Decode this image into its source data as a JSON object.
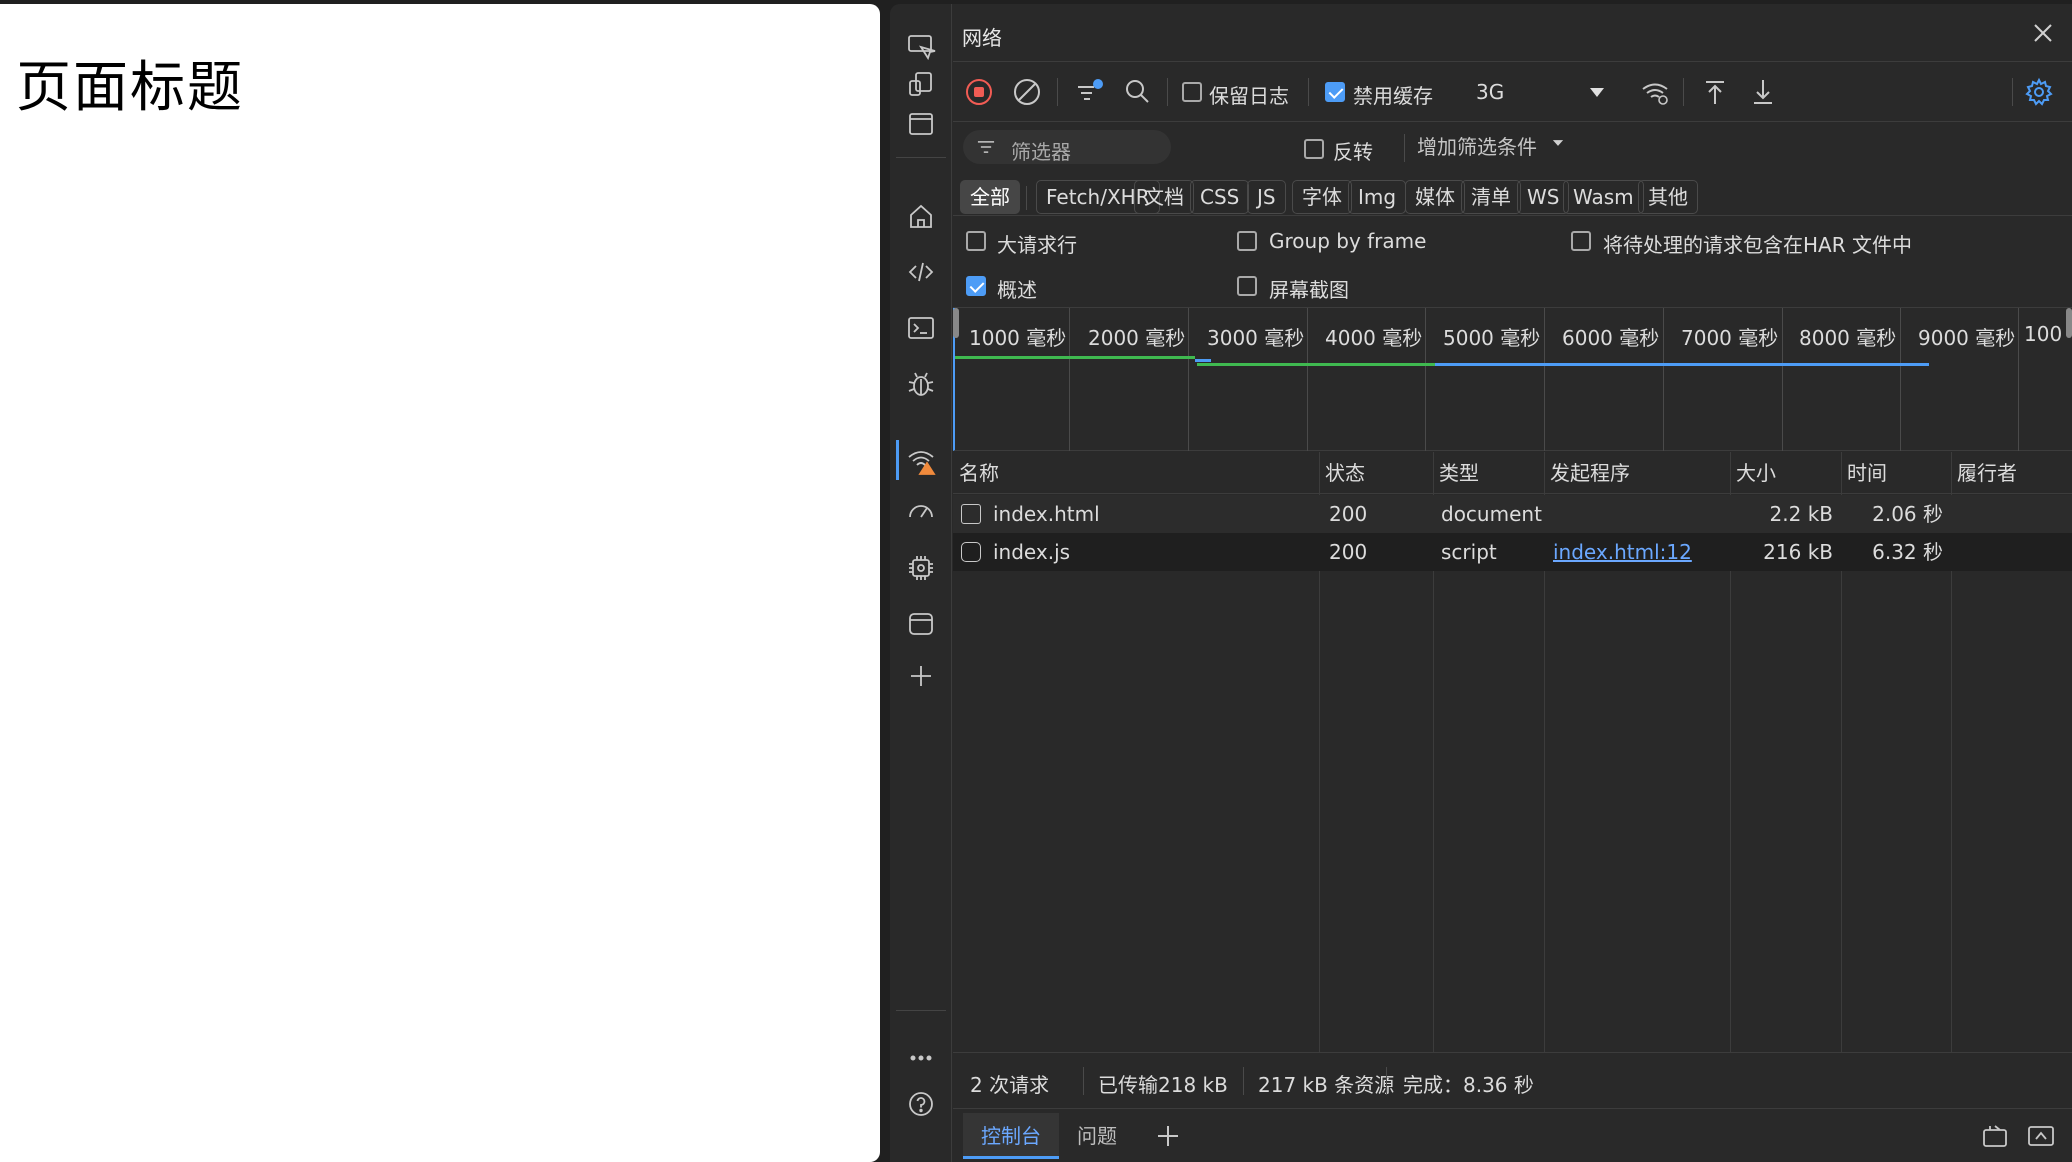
{
  "page": {
    "title": "页面标题"
  },
  "panel": {
    "title": "网络"
  },
  "toolbar": {
    "preserve_log": "保留日志",
    "disable_cache": "禁用缓存",
    "throttling": "3G"
  },
  "filter": {
    "placeholder": "筛选器",
    "invert": "反转",
    "more_filters": "增加筛选条件"
  },
  "types": [
    "全部",
    "Fetch/XHR",
    "文档",
    "CSS",
    "JS",
    "字体",
    "Img",
    "媒体",
    "清单",
    "WS",
    "Wasm",
    "其他"
  ],
  "options": {
    "big_rows": "大请求行",
    "group_by_frame": "Group by frame",
    "har_pending": "将待处理的请求包含在HAR 文件中",
    "overview": "概述",
    "screenshots": "屏幕截图"
  },
  "overview": {
    "ticks": [
      "1000 毫秒",
      "2000 毫秒",
      "3000 毫秒",
      "4000 毫秒",
      "5000 毫秒",
      "6000 毫秒",
      "7000 毫秒",
      "8000 毫秒",
      "9000 毫秒",
      "100"
    ]
  },
  "table": {
    "headers": {
      "name": "名称",
      "status": "状态",
      "type": "类型",
      "initiator": "发起程序",
      "size": "大小",
      "time": "时间",
      "fulfilled_by": "履行者"
    },
    "rows": [
      {
        "name": "index.html",
        "status": "200",
        "type": "document",
        "initiator": "",
        "size": "2.2 kB",
        "time": "2.06 秒"
      },
      {
        "name": "index.js",
        "status": "200",
        "type": "script",
        "initiator": "index.html:12",
        "size": "216 kB",
        "time": "6.32 秒"
      }
    ]
  },
  "status": {
    "requests": "2 次请求",
    "transferred": "已传输218 kB",
    "resources": "217 kB 条资源",
    "finish": "完成：8.36 秒"
  },
  "drawer": {
    "console": "控制台",
    "issues": "问题"
  },
  "colors": {
    "accent": "#4d9cf6",
    "record": "#f25c54",
    "background": "#292929",
    "link": "#6ba8ff"
  }
}
